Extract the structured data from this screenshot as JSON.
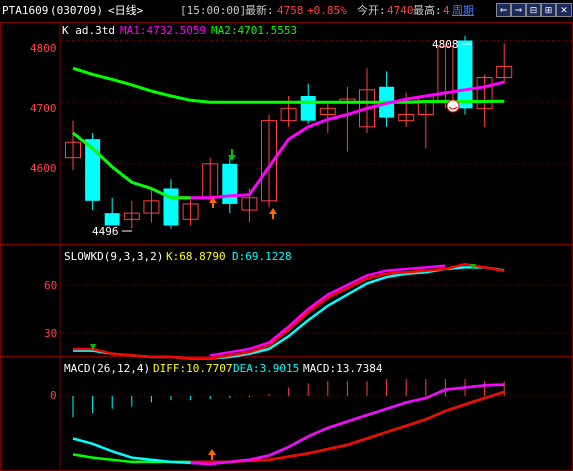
{
  "header": {
    "symbol": "PTA1609",
    "code": "(030709)",
    "period": "<日线>",
    "time": "[15:00:00]",
    "latest_label": "最新:",
    "latest_value": "4758",
    "change_pct": "+0.85%",
    "open_label": "今开:",
    "open_value": "4740",
    "high_label": "最高:",
    "high_value": "4",
    "cycle_label": "周期",
    "nav_buttons": [
      "⇐",
      "⇒",
      "⊟",
      "⊞",
      "✕"
    ]
  },
  "main_panel": {
    "info_k": "K  ad.3td",
    "ma1": "MA1:4732.5059",
    "ma2": "MA2:4701.5553",
    "y_ticks": [
      "4800",
      "4700",
      "4600"
    ],
    "high_mark": "4808",
    "low_mark": "4496"
  },
  "kd_panel": {
    "name": "SLOWKD(9,3,3,2)",
    "k": "K:68.8790",
    "d": "D:69.1228",
    "y_ticks": [
      "60",
      "30"
    ]
  },
  "macd_panel": {
    "name": "MACD(26,12,4)",
    "diff": "DIFF:10.7707",
    "dea": "DEA:3.9015",
    "macd": "MACD:13.7384",
    "y_ticks": [
      "0"
    ]
  },
  "colors": {
    "up": "#ff4040",
    "down": "#00ffff",
    "ma1": "#ff00ff",
    "ma2": "#00ff00",
    "grid": "#7a0000",
    "yellow": "#ffff00",
    "blue_link": "#4080ff"
  },
  "chart_data": {
    "type": "candlestick",
    "y_range": [
      4470,
      4830
    ],
    "candles": [
      {
        "o": 4610,
        "h": 4670,
        "l": 4590,
        "c": 4635
      },
      {
        "o": 4640,
        "h": 4650,
        "l": 4525,
        "c": 4540
      },
      {
        "o": 4520,
        "h": 4545,
        "l": 4510,
        "c": 4500
      },
      {
        "o": 4510,
        "h": 4540,
        "l": 4495,
        "c": 4520
      },
      {
        "o": 4520,
        "h": 4560,
        "l": 4505,
        "c": 4540
      },
      {
        "o": 4560,
        "h": 4575,
        "l": 4495,
        "c": 4500
      },
      {
        "o": 4510,
        "h": 4545,
        "l": 4500,
        "c": 4535
      },
      {
        "o": 4545,
        "h": 4610,
        "l": 4540,
        "c": 4600
      },
      {
        "o": 4600,
        "h": 4610,
        "l": 4520,
        "c": 4535
      },
      {
        "o": 4525,
        "h": 4560,
        "l": 4505,
        "c": 4545
      },
      {
        "o": 4540,
        "h": 4680,
        "l": 4530,
        "c": 4670
      },
      {
        "o": 4670,
        "h": 4710,
        "l": 4660,
        "c": 4690
      },
      {
        "o": 4710,
        "h": 4730,
        "l": 4665,
        "c": 4670
      },
      {
        "o": 4680,
        "h": 4700,
        "l": 4650,
        "c": 4690
      },
      {
        "o": 4700,
        "h": 4725,
        "l": 4620,
        "c": 4705
      },
      {
        "o": 4660,
        "h": 4755,
        "l": 4650,
        "c": 4720
      },
      {
        "o": 4725,
        "h": 4750,
        "l": 4660,
        "c": 4675
      },
      {
        "o": 4670,
        "h": 4715,
        "l": 4660,
        "c": 4680
      },
      {
        "o": 4680,
        "h": 4700,
        "l": 4625,
        "c": 4710
      },
      {
        "o": 4700,
        "h": 4795,
        "l": 4690,
        "c": 4790
      },
      {
        "o": 4800,
        "h": 4808,
        "l": 4680,
        "c": 4690
      },
      {
        "o": 4690,
        "h": 4745,
        "l": 4660,
        "c": 4740
      },
      {
        "o": 4740,
        "h": 4795,
        "l": 4730,
        "c": 4758
      }
    ],
    "ma1": [
      4650,
      4625,
      4595,
      4570,
      4560,
      4545,
      4545,
      4545,
      4548,
      4550,
      4595,
      4640,
      4660,
      4672,
      4680,
      4690,
      4698,
      4705,
      4710,
      4715,
      4720,
      4725,
      4732.5
    ],
    "ma2": [
      4755,
      4745,
      4737,
      4728,
      4718,
      4710,
      4703,
      4700,
      4700,
      4700,
      4700,
      4700,
      4700,
      4700,
      4700,
      4700,
      4700,
      4700,
      4701,
      4701,
      4701,
      4701,
      4701.5
    ],
    "kd_k": [
      20,
      20,
      17,
      16,
      15,
      15,
      14,
      14,
      16,
      18,
      22,
      32,
      43,
      52,
      58,
      64,
      67,
      68,
      69,
      70,
      73,
      71,
      68.9
    ],
    "kd_d": [
      19,
      19,
      17,
      16,
      15,
      15,
      14,
      14,
      15,
      17,
      20,
      28,
      38,
      47,
      54,
      61,
      65,
      67,
      68,
      70,
      71,
      71,
      69.1
    ],
    "macd_diff": [
      -40,
      -45,
      -52,
      -58,
      -60,
      -62,
      -63,
      -64,
      -62,
      -60,
      -56,
      -48,
      -38,
      -30,
      -24,
      -18,
      -12,
      -6,
      -2,
      6,
      8,
      10,
      10.77
    ],
    "macd_dea": [
      -55,
      -58,
      -60,
      -62,
      -62,
      -62,
      -62,
      -62,
      -62,
      -61,
      -60,
      -57,
      -54,
      -50,
      -46,
      -40,
      -34,
      -28,
      -22,
      -14,
      -8,
      -2,
      3.9
    ],
    "macd_hist": [
      -20,
      -16,
      -12,
      -10,
      -6,
      -4,
      -4,
      -3,
      -2,
      -1,
      2,
      8,
      12,
      14,
      14,
      14,
      16,
      16,
      16,
      16,
      16,
      14,
      13.7
    ]
  }
}
